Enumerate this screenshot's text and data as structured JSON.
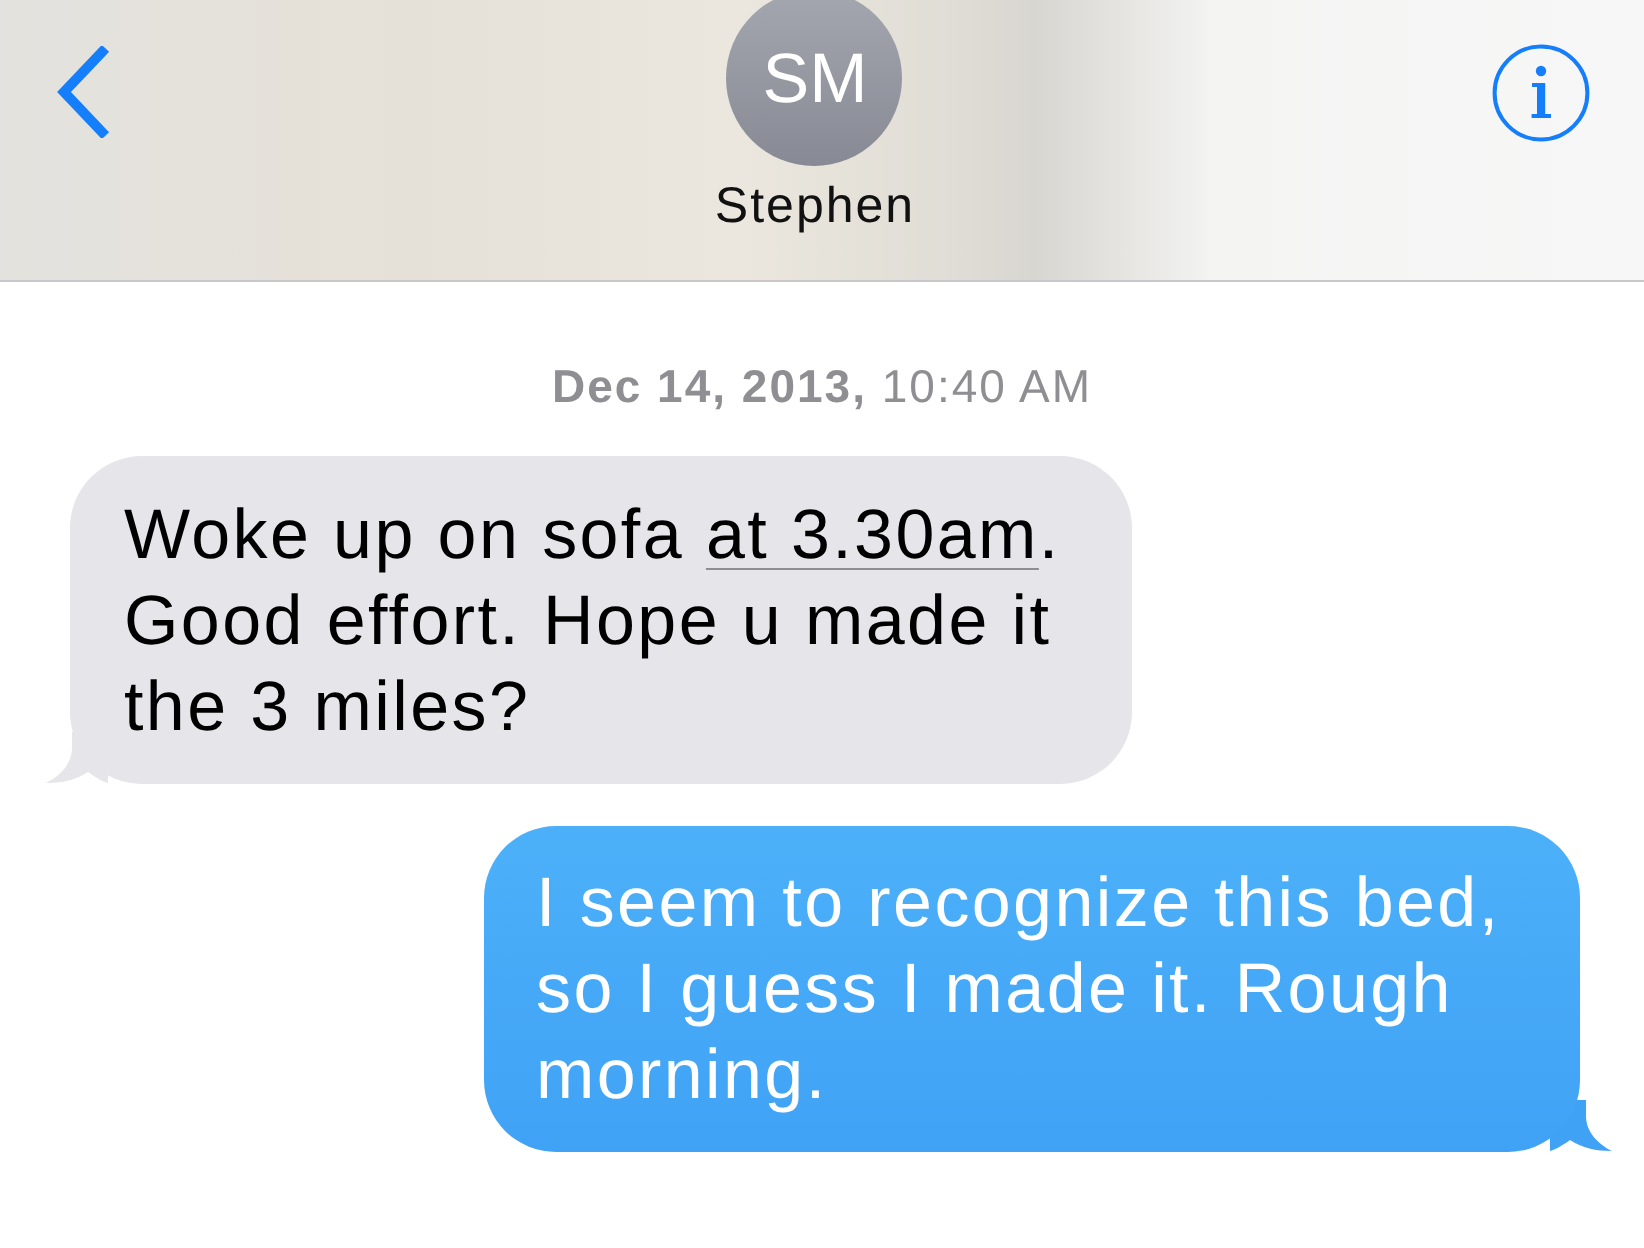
{
  "header": {
    "contact": {
      "initials": "SM",
      "name": "Stephen"
    }
  },
  "messages": [
    {
      "kind": "timestamp",
      "text": "**Dec 14, 2013,** 10:40 AM"
    },
    {
      "kind": "received",
      "segments": [
        {
          "kind": "text",
          "text": "Woke up on sofa "
        },
        {
          "kind": "link",
          "text": "at 3.30am"
        },
        {
          "kind": "text",
          "text": ". Good effort. Hope u made it the 3 miles?"
        }
      ]
    },
    {
      "kind": "sent",
      "segments": [
        {
          "kind": "text",
          "text": "I seem to recognize this bed, so I guess I made it. Rough morning."
        }
      ]
    }
  ]
}
